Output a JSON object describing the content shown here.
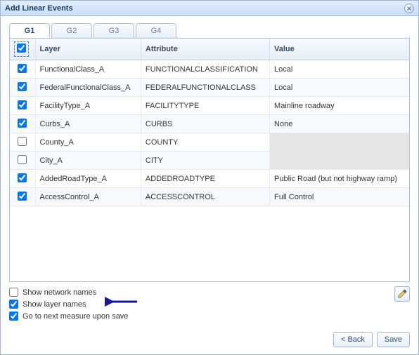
{
  "window": {
    "title": "Add Linear Events"
  },
  "tabs": [
    {
      "label": "G1",
      "active": true
    },
    {
      "label": "G2",
      "active": false
    },
    {
      "label": "G3",
      "active": false
    },
    {
      "label": "G4",
      "active": false
    }
  ],
  "columns": {
    "layer": "Layer",
    "attribute": "Attribute",
    "value": "Value"
  },
  "header_checked": true,
  "rows": [
    {
      "checked": true,
      "layer": "FunctionalClass_A",
      "attribute": "FUNCTIONALCLASSIFICATION",
      "value": "Local",
      "value_enabled": true
    },
    {
      "checked": true,
      "layer": "FederalFunctionalClass_A",
      "attribute": "FEDERALFUNCTIONALCLASS",
      "value": "Local",
      "value_enabled": true
    },
    {
      "checked": true,
      "layer": "FacilityType_A",
      "attribute": "FACILITYTYPE",
      "value": "Mainline roadway",
      "value_enabled": true
    },
    {
      "checked": true,
      "layer": "Curbs_A",
      "attribute": "CURBS",
      "value": "None",
      "value_enabled": true
    },
    {
      "checked": false,
      "layer": "County_A",
      "attribute": "COUNTY",
      "value": "",
      "value_enabled": false
    },
    {
      "checked": false,
      "layer": "City_A",
      "attribute": "CITY",
      "value": "",
      "value_enabled": false
    },
    {
      "checked": true,
      "layer": "AddedRoadType_A",
      "attribute": "ADDEDROADTYPE",
      "value": "Public Road (but not highway ramp)",
      "value_enabled": true
    },
    {
      "checked": true,
      "layer": "AccessControl_A",
      "attribute": "ACCESSCONTROL",
      "value": "Full Control",
      "value_enabled": true
    }
  ],
  "options": {
    "show_network_names": {
      "label": "Show network names",
      "checked": false
    },
    "show_layer_names": {
      "label": "Show layer names",
      "checked": true
    },
    "go_next_measure": {
      "label": "Go to next measure upon save",
      "checked": true
    }
  },
  "buttons": {
    "back": "< Back",
    "save": "Save"
  }
}
